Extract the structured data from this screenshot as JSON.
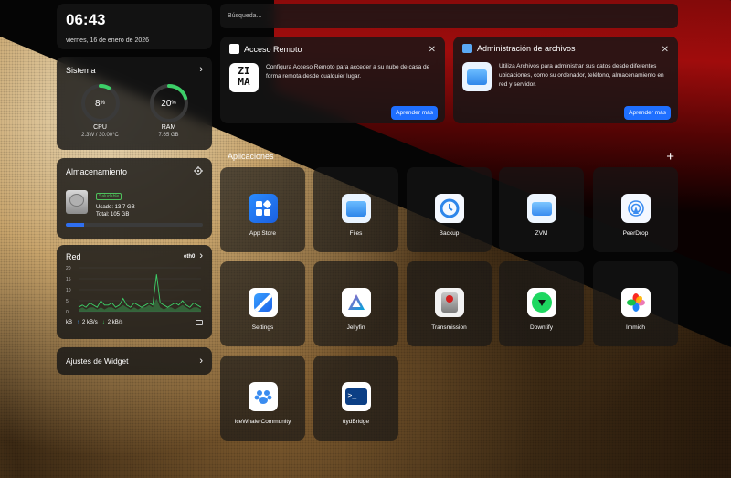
{
  "clock": {
    "time": "06:43",
    "date": "viernes, 16 de enero de 2026"
  },
  "system": {
    "title": "Sistema",
    "cpu": {
      "value": "8",
      "unit": "%",
      "label": "CPU",
      "detail": "2.3W / 30.00°C",
      "percent": 8
    },
    "ram": {
      "value": "20",
      "unit": "%",
      "label": "RAM",
      "detail": "7.65 GB",
      "percent": 20
    }
  },
  "storage": {
    "title": "Almacenamiento",
    "status": "Saludable",
    "used": "Usado: 13.7 GB",
    "total": "Total: 105 GB",
    "used_fraction": 0.13
  },
  "network": {
    "title": "Red",
    "interface": "eth0",
    "y_ticks": [
      "20",
      "15",
      "10",
      "5",
      "0"
    ],
    "unit": "kB",
    "up": "2 kB/s",
    "down": "2 kB/s",
    "series_up": [
      2,
      3,
      2,
      4,
      3,
      2,
      5,
      3,
      3,
      4,
      2,
      3,
      6,
      3,
      2,
      4,
      3,
      2,
      3,
      4,
      3,
      17,
      4,
      3,
      2,
      3,
      4,
      3,
      5,
      3,
      2,
      4,
      3,
      2
    ],
    "series_down": [
      1,
      2,
      1,
      2,
      2,
      1,
      2,
      1,
      2,
      2,
      1,
      2,
      3,
      2,
      1,
      2,
      1,
      2,
      2,
      3,
      2,
      6,
      2,
      1,
      2,
      2,
      1,
      2,
      3,
      2,
      1,
      2,
      2,
      1
    ]
  },
  "widget_settings": {
    "label": "Ajustes de Widget"
  },
  "search": {
    "placeholder": "Búsqueda..."
  },
  "notifications": {
    "remote": {
      "title": "Acceso Remoto",
      "text": "Configura Acceso Remoto para acceder a su nube de casa de forma remota desde cualquier lugar.",
      "button": "Aprender más",
      "logo_text": "ZI MA"
    },
    "files": {
      "title": "Administración de archivos",
      "text": "Utiliza Archivos para administrar sus datos desde diferentes ubicaciones, como su ordenador, teléfono, almacenamiento en red y servidor.",
      "button": "Aprender más"
    }
  },
  "apps_section": {
    "title": "Aplicaciones"
  },
  "apps": [
    {
      "name": "App Store",
      "icon": "app-store-icon"
    },
    {
      "name": "Files",
      "icon": "files-icon"
    },
    {
      "name": "Backup",
      "icon": "backup-icon"
    },
    {
      "name": "ZVM",
      "icon": "zvm-icon"
    },
    {
      "name": "PeerDrop",
      "icon": "peerdrop-icon"
    },
    {
      "name": "Settings",
      "icon": "settings-icon"
    },
    {
      "name": "Jellyfin",
      "icon": "jellyfin-icon"
    },
    {
      "name": "Transmission",
      "icon": "transmission-icon"
    },
    {
      "name": "Downtify",
      "icon": "downtify-icon"
    },
    {
      "name": "Immich",
      "icon": "immich-icon"
    },
    {
      "name": "IceWhale Community",
      "icon": "icewhale-community-icon"
    },
    {
      "name": "ttydBridge",
      "icon": "ttydbridge-icon"
    }
  ]
}
